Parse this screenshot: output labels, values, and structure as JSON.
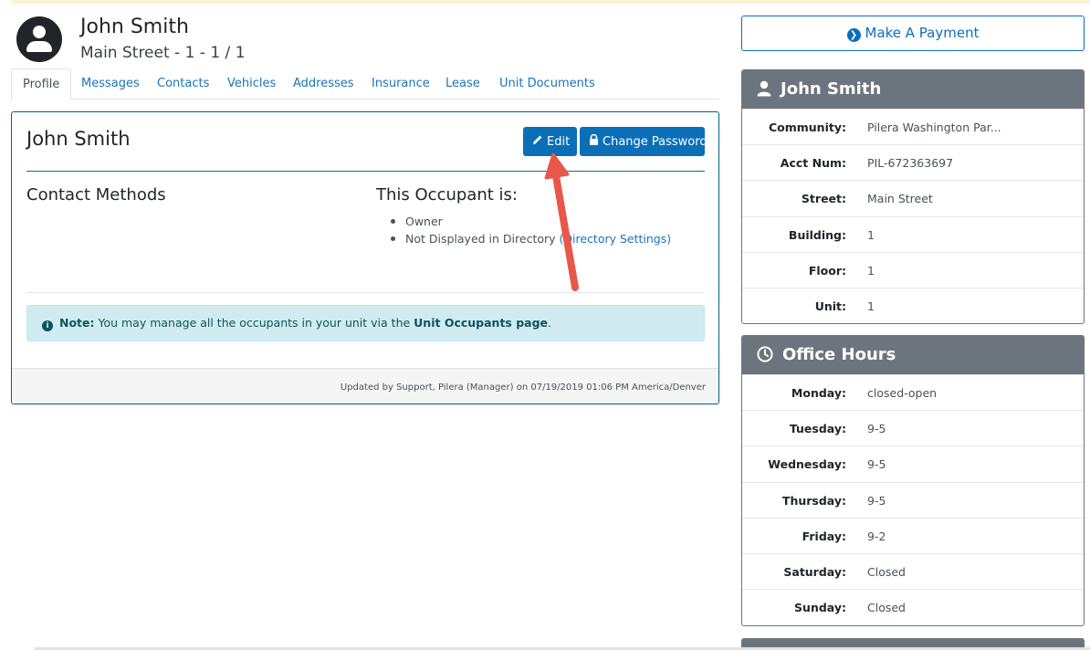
{
  "header": {
    "name": "John Smith",
    "subtitle": "Main Street - 1 - 1 / 1"
  },
  "tabs": [
    {
      "label": "Profile",
      "active": true
    },
    {
      "label": "Messages"
    },
    {
      "label": "Contacts"
    },
    {
      "label": "Vehicles"
    },
    {
      "label": "Addresses"
    },
    {
      "label": "Insurance"
    },
    {
      "label": "Lease"
    },
    {
      "label": "Unit Documents"
    }
  ],
  "profile_card": {
    "title": "John Smith",
    "edit_label": "Edit",
    "change_password_label": "Change Password",
    "contact_methods_heading": "Contact Methods",
    "occupant_heading": "This Occupant is:",
    "occupant_items": {
      "owner": "Owner",
      "directory": "Not Displayed in Directory",
      "directory_link": "(Directory Settings)"
    },
    "note": {
      "label": "Note:",
      "text": " You may manage all the occupants in your unit via the ",
      "link": "Unit Occupants page",
      "end": "."
    },
    "footer": "Updated by Support, Pilera (Manager) on 07/19/2019 01:06 PM America/Denver"
  },
  "payment_button": "Make A Payment",
  "user_panel": {
    "title": "John Smith",
    "rows": [
      {
        "label": "Community:",
        "value": "Pilera Washington Par..."
      },
      {
        "label": "Acct Num:",
        "value": "PIL-672363697"
      },
      {
        "label": "Street:",
        "value": "Main Street"
      },
      {
        "label": "Building:",
        "value": "1"
      },
      {
        "label": "Floor:",
        "value": "1"
      },
      {
        "label": "Unit:",
        "value": "1"
      }
    ]
  },
  "office_hours": {
    "title": "Office Hours",
    "rows": [
      {
        "label": "Monday:",
        "value": "closed-open"
      },
      {
        "label": "Tuesday:",
        "value": "9-5"
      },
      {
        "label": "Wednesday:",
        "value": "9-5"
      },
      {
        "label": "Thursday:",
        "value": "9-5"
      },
      {
        "label": "Friday:",
        "value": "9-2"
      },
      {
        "label": "Saturday:",
        "value": "Closed"
      },
      {
        "label": "Sunday:",
        "value": "Closed"
      }
    ]
  },
  "colors": {
    "primary": "#0b6fb8",
    "card_border": "#005f86",
    "panel_header": "#6c757d",
    "note_bg": "#d1ecf1",
    "annotation_arrow": "#e8574a"
  }
}
